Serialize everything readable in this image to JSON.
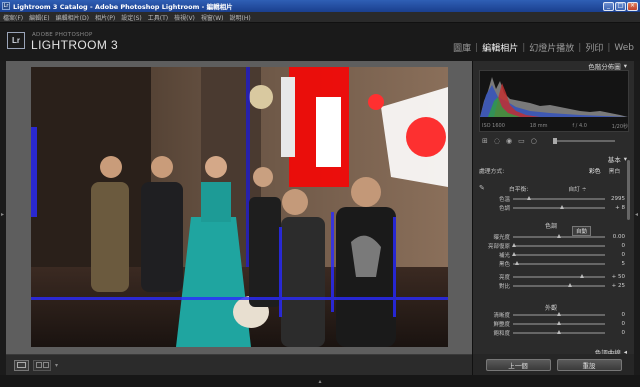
{
  "window": {
    "title": "Lightroom 3 Catalog - Adobe Photoshop Lightroom - 編輯相片",
    "app_icon": "Lr",
    "buttons": [
      "_",
      "□",
      "×"
    ]
  },
  "menu": [
    "檔案(F)",
    "編輯(E)",
    "編輯相片(D)",
    "相片(P)",
    "設定(S)",
    "工具(T)",
    "檢視(V)",
    "視窗(W)",
    "說明(H)"
  ],
  "identity": {
    "logo": "Lr",
    "brand_small": "ADOBE PHOTOSHOP",
    "brand_big": "LIGHTROOM 3"
  },
  "modules": [
    {
      "label": "圖庫",
      "active": false
    },
    {
      "label": "編輯相片",
      "active": true
    },
    {
      "label": "幻燈片播放",
      "active": false
    },
    {
      "label": "列印",
      "active": false
    },
    {
      "label": "Web",
      "active": false
    }
  ],
  "histogram": {
    "title": "色階分佈圖",
    "info": [
      "ISO 1600",
      "18 mm",
      "f / 4.0",
      "1/20秒"
    ]
  },
  "basic": {
    "title": "基本",
    "treatment_label": "處理方式:",
    "treatment_color": "彩色",
    "treatment_bw": "黑白",
    "wb_label": "白平衡:",
    "wb_value": "自訂 ÷",
    "tone_label": "色調",
    "auto_label": "自動",
    "presence_label": "外觀",
    "sliders_wb": [
      {
        "label": "色溫",
        "value": "2995",
        "pos": 0.18
      },
      {
        "label": "色調",
        "value": "+ 8",
        "pos": 0.54
      }
    ],
    "sliders_tone": [
      {
        "label": "曝光度",
        "value": "0.00",
        "pos": 0.5
      },
      {
        "label": "亮部復原",
        "value": "0",
        "pos": 0.02
      },
      {
        "label": "補光",
        "value": "0",
        "pos": 0.02
      },
      {
        "label": "黑色",
        "value": "5",
        "pos": 0.05
      }
    ],
    "sliders_bc": [
      {
        "label": "亮度",
        "value": "+ 50",
        "pos": 0.75
      },
      {
        "label": "對比",
        "value": "+ 25",
        "pos": 0.62
      }
    ],
    "sliders_presence": [
      {
        "label": "清晰度",
        "value": "0",
        "pos": 0.5
      },
      {
        "label": "鮮艷度",
        "value": "0",
        "pos": 0.5
      },
      {
        "label": "飽和度",
        "value": "0",
        "pos": 0.5
      }
    ],
    "next_section": "色調曲線"
  },
  "bottom_buttons": {
    "previous": "上一個",
    "reset": "重設"
  },
  "colors": {
    "title_bar": "#1f4ea3",
    "panel_bg": "#2b2b2b",
    "center_bg": "#5e5e5e",
    "clipping_highlight": "#ff0000",
    "clipping_shadow": "#2020ff"
  }
}
